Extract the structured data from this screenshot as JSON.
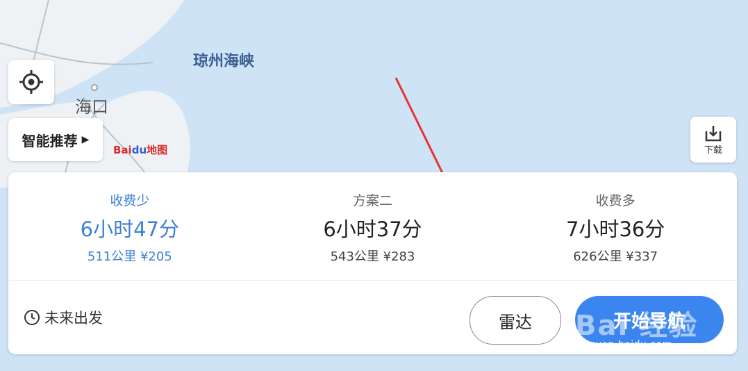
{
  "map": {
    "strait_label": "琼州海峡",
    "city_label": "海口",
    "logo_text_bai": "Bai",
    "logo_text_du": "du",
    "logo_text_map": "地图",
    "colors": {
      "sea": "#cfe3f7",
      "land": "#eef2f5",
      "road": "#b9c3cf"
    }
  },
  "controls": {
    "locate_icon": "crosshair-icon",
    "recommend_label": "智能推荐",
    "download_label": "下载"
  },
  "routes": [
    {
      "name": "收费少",
      "time": "6小时47分",
      "meta": "511公里  ¥205",
      "active": true
    },
    {
      "name": "方案二",
      "time": "6小时37分",
      "meta": "543公里  ¥283",
      "active": false
    },
    {
      "name": "收费多",
      "time": "7小时36分",
      "meta": "626公里  ¥337",
      "active": false
    }
  ],
  "actions": {
    "depart_label": "未来出发",
    "radar_label": "雷达",
    "navigate_label": "开始导航"
  },
  "watermark": {
    "text": "Bai 经验",
    "url": "jingyan.baidu.com"
  },
  "colors": {
    "accent": "#3e7fd6",
    "nav_button": "#3b86ee",
    "arrow": "#e8332e"
  }
}
